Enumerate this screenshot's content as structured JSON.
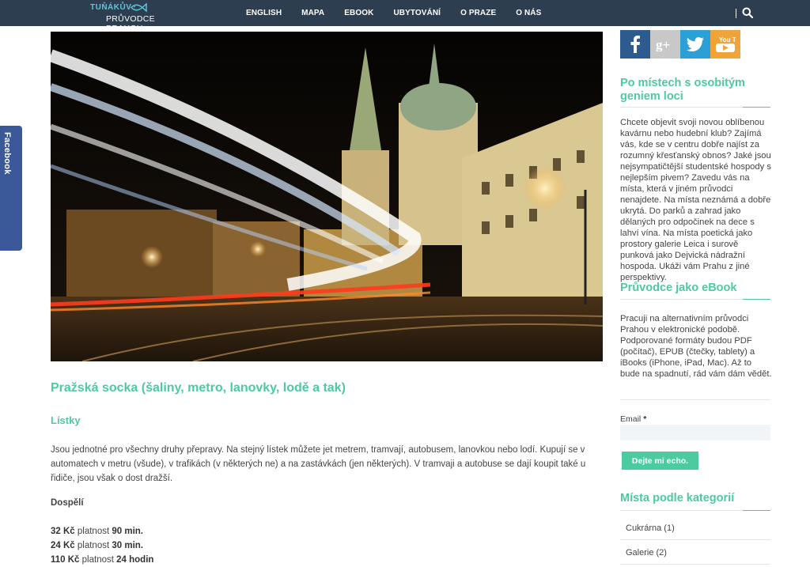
{
  "header": {
    "logo_line1": "TUŇÁKŮV",
    "logo_line2": "PRŮVODCE PRAHOU",
    "nav": [
      "ENGLISH",
      "MAPA",
      "EBOOK",
      "UBYTOVÁNÍ",
      "O PRAZE",
      "O NÁS"
    ],
    "search_icon": "search-icon"
  },
  "side_tab": {
    "label": "Facebook"
  },
  "article": {
    "title": "Pražská socka (šaliny, metro, lanovky, lodě a tak)",
    "section": "Lístky",
    "paragraph": "Jsou jednotné pro všechny druhy přepravy. Na stejný lístek můžete jet metrem, tramvají, autobusem, lanovkou nebo lodí. Kupují se v automatech v metru (všude), v trafikách (v některých ne) a na zastávkách (jen některých). V tramvaji a autobuse se dají koupit také u řidiče, jsou však o dost dražší.",
    "adults_heading": "Dospělí",
    "prices": [
      {
        "price": "32 Kč",
        "label": "platnost",
        "duration": "90 min."
      },
      {
        "price": "24 Kč",
        "label": "platnost",
        "duration": "30 min."
      },
      {
        "price": "110 Kč",
        "label": "platnost",
        "duration": "24 hodin"
      }
    ]
  },
  "sidebar": {
    "social": [
      "facebook-icon",
      "google-plus-icon",
      "twitter-icon",
      "youtube-icon"
    ],
    "youtube_text": "You Tube",
    "block1_title": "Po místech s osobitým geniem loci",
    "block1_text": "Chcete objevit svoji novou oblíbenou kavárnu nebo hudební klub? Zajímá vás, kde se v centru dobře najíst za rozumný křesťanský obnos? Jaké jsou nejsympatičtější studentské hospody s nejlepším pivem? Zavedu vás na místa, která v jiném průvodci nenajdete. Na místa neznámá a dobře ukrytá. Do parků a zahrad jako dělaných pro odpočinek na dece s lahví vína. Na místa poetická jako prostory galerie Leica i surově punková jako Dejvická nádražní hospoda. Ukáži vám Prahu z jiné perspektivy.",
    "block2_title": "Průvodce jako eBook",
    "block2_text": "Pracuji na alternativním průvodci Prahou v elektronické podobě. Podporované formáty budou PDF (počítač), EPUB (čtečky, tablety) a iBooks (iPhone, iPad, Mac). Až to bude na spadnutí, rád vám dám vědět.",
    "email_label": "Email",
    "email_required": "*",
    "email_value": "",
    "submit_label": "Dejte mi echo.",
    "block3_title": "Místa podle kategorií",
    "categories": [
      "Cukrárna (1)",
      "Galerie (2)"
    ]
  },
  "colors": {
    "topbar": "#2c3e50",
    "accent": "#4ccaa0",
    "facebook": "#3b5998"
  }
}
